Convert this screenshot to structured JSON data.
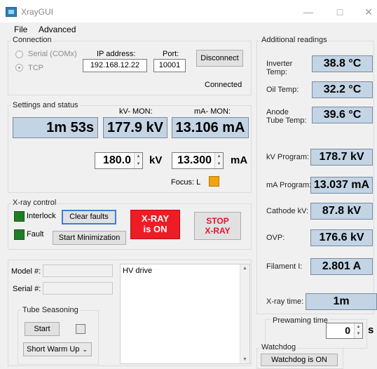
{
  "window": {
    "title": "XrayGUI"
  },
  "menu": {
    "file": "File",
    "advanced": "Advanced"
  },
  "connection": {
    "title": "Connection",
    "serial_label": "Serial (COMx)",
    "tcp_label": "TCP",
    "ip_label": "IP address:",
    "ip_value": "192.168.12.22",
    "port_label": "Port:",
    "port_value": "10001",
    "disconnect_label": "Disconnect",
    "status": "Connected"
  },
  "settings": {
    "title": "Settings and status",
    "kv_mon_label": "kV- MON:",
    "ma_mon_label": "mA- MON:",
    "time_readout": "1m 53s",
    "kv_readout": "177.9 kV",
    "ma_readout": "13.106 mA",
    "kv_set_value": "180.0",
    "kv_unit": "kV",
    "ma_set_value": "13.300",
    "ma_unit": "mA",
    "focus_label": "Focus: L",
    "focus_color": "#f4a20c"
  },
  "xray_control": {
    "title": "X-ray control",
    "interlock_label": "Interlock",
    "fault_label": "Fault",
    "led_color": "#1e7d25",
    "clear_faults_label": "Clear faults",
    "start_min_label": "Start Minimization",
    "xray_status_line1": "X-RAY",
    "xray_status_line2": "is ON",
    "xray_status_color": "#ee1c24",
    "stop_line1": "STOP",
    "stop_line2": "X-RAY",
    "stop_text_color": "#e8142b"
  },
  "device": {
    "model_label": "Model #:",
    "model_value": "",
    "serial_label": "Serial #:",
    "serial_value": "",
    "hv_drive_label": "HV drive"
  },
  "seasoning": {
    "title": "Tube Seasoning",
    "start_label": "Start",
    "mode_value": "Short Warm Up"
  },
  "additional": {
    "title": "Additional readings",
    "items": [
      {
        "label": "Inverter Temp:",
        "value": "38.8 °C"
      },
      {
        "label": "Oil Temp:",
        "value": "32.2 °C"
      },
      {
        "label": "Anode Tube Temp:",
        "value": "39.6 °C"
      },
      {
        "label": "kV Program:",
        "value": "178.7 kV"
      },
      {
        "label": "mA Program:",
        "value": "13.037 mA"
      },
      {
        "label": "Cathode kV:",
        "value": "87.8 kV"
      },
      {
        "label": "OVP:",
        "value": "176.6 kV"
      },
      {
        "label": "Filament I:",
        "value": "2.801 A"
      },
      {
        "label": "X-ray time:",
        "value": "1m"
      }
    ]
  },
  "prewarming": {
    "title": "Prewaming time",
    "value": "0",
    "unit": "s"
  },
  "watchdog": {
    "title": "Watchdog",
    "status": "Watchdog is ON"
  }
}
